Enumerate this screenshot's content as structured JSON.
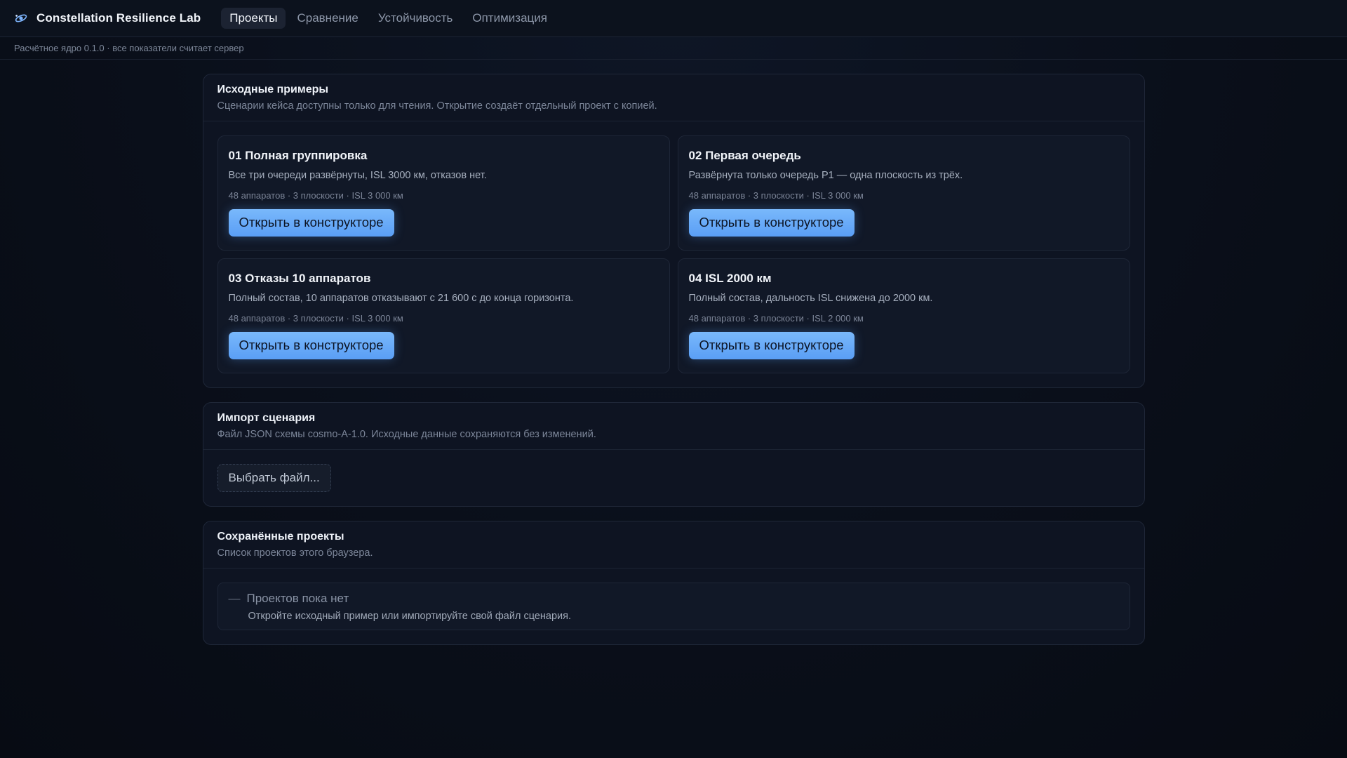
{
  "app": {
    "name": "Constellation Resilience Lab",
    "icon": "orbit-icon"
  },
  "nav": {
    "tabs": [
      {
        "label": "Проекты",
        "active": true
      },
      {
        "label": "Сравнение",
        "active": false
      },
      {
        "label": "Устойчивость",
        "active": false
      },
      {
        "label": "Оптимизация",
        "active": false
      }
    ]
  },
  "subbar": {
    "text": "Расчётное ядро 0.1.0 · все показатели считает сервер"
  },
  "examples": {
    "title": "Исходные примеры",
    "subtitle": "Сценарии кейса доступны только для чтения. Открытие создаёт отдельный проект с копией.",
    "cards": [
      {
        "title": "01 Полная группировка",
        "desc": "Все три очереди развёрнуты, ISL 3000 км, отказов нет.",
        "meta": "48 аппаратов · 3 плоскости · ISL 3 000 км",
        "button": "Открыть в конструкторе"
      },
      {
        "title": "02 Первая очередь",
        "desc": "Развёрнута только очередь P1 — одна плоскость из трёх.",
        "meta": "48 аппаратов · 3 плоскости · ISL 3 000 км",
        "button": "Открыть в конструкторе"
      },
      {
        "title": "03 Отказы 10 аппаратов",
        "desc": "Полный состав, 10 аппаратов отказывают с 21 600 с до конца горизонта.",
        "meta": "48 аппаратов · 3 плоскости · ISL 3 000 км",
        "button": "Открыть в конструкторе"
      },
      {
        "title": "04 ISL 2000 км",
        "desc": "Полный состав, дальность ISL снижена до 2000 км.",
        "meta": "48 аппаратов · 3 плоскости · ISL 2 000 км",
        "button": "Открыть в конструкторе"
      }
    ]
  },
  "import": {
    "title": "Импорт сценария",
    "subtitle": "Файл JSON схемы cosmo-A-1.0. Исходные данные сохраняются без изменений.",
    "button": "Выбрать файл..."
  },
  "saved": {
    "title": "Сохранённые проекты",
    "subtitle": "Список проектов этого браузера.",
    "empty_dash": "—",
    "empty_title": "Проектов пока нет",
    "empty_sub": "Откройте исходный пример или импортируйте свой файл сценария."
  },
  "colors": {
    "accent": "#6aaaf8",
    "background": "#0a0f1a",
    "panel": "#0e1422"
  }
}
